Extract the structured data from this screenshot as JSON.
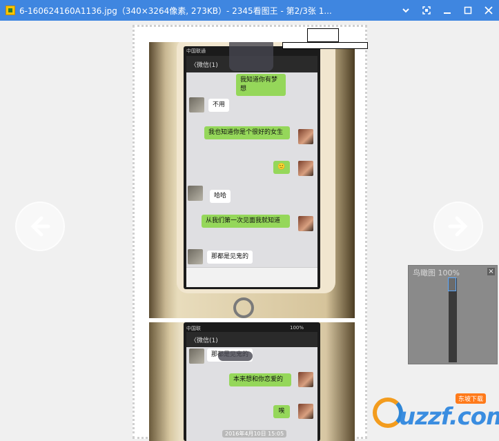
{
  "window": {
    "title": "6-160624160A1136.jpg（340×3264像素, 273KB）- 2345看图王 - 第2/3张 1..."
  },
  "chat_screen_1": {
    "status_carrier": "中国联通",
    "header_back": "〈微信(1)",
    "messages": [
      {
        "side": "me",
        "text": "我知道你有梦想"
      },
      {
        "side": "other",
        "text": "不用"
      },
      {
        "side": "me",
        "text": "我也知道你是个很好的女生"
      },
      {
        "side": "me",
        "text": "🙂"
      },
      {
        "side": "other",
        "text": "哈哈"
      },
      {
        "side": "me",
        "text": "从我们第一次见面我就知道"
      },
      {
        "side": "other",
        "text": "那都是见鬼的"
      }
    ]
  },
  "chat_screen_2": {
    "status_carrier": "中国联",
    "status_battery": "100%",
    "header_back": "〈微信(1)",
    "messages": [
      {
        "side": "other",
        "text": "那都是见鬼的"
      },
      {
        "side": "me",
        "text": "本来想和你恋爱的"
      },
      {
        "side": "me",
        "text": "唉"
      }
    ],
    "timestamp": "2016年4月10日 15:05"
  },
  "thumbnail_panel": {
    "title": "鸟瞰图 100%",
    "close_label": "×"
  },
  "watermark": {
    "brand": "uzzf.com",
    "badge": "东坡下载"
  },
  "icons": {
    "prev": "left-arrow-icon",
    "next": "right-arrow-icon",
    "fullscreen": "fullscreen-icon",
    "minimize": "minimize-icon",
    "maximize": "maximize-icon",
    "close": "close-icon",
    "dropdown": "chevron-down-icon"
  }
}
